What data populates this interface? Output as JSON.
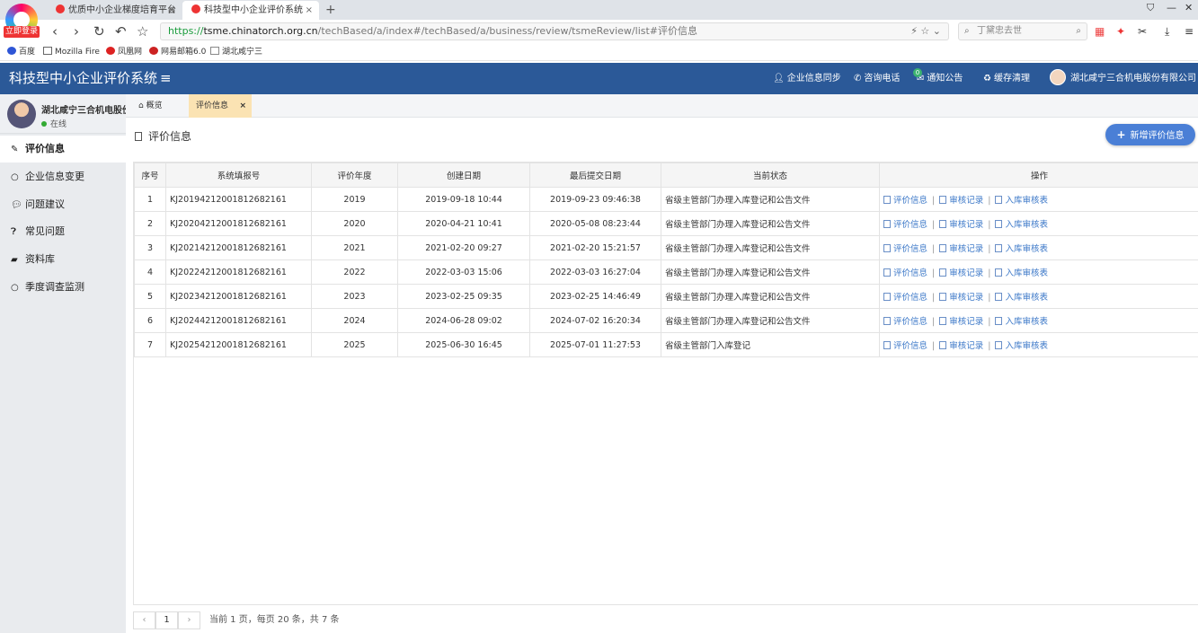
{
  "browser": {
    "login_badge": "立即登录",
    "tabs": [
      {
        "title": "优质中小企业梯度培育平台",
        "close": "×"
      },
      {
        "title": "科技型中小企业评价系统",
        "close": "×"
      }
    ],
    "new_tab": "+",
    "url_scheme": "https://",
    "url_host": "tsme.chinatorch.org.cn",
    "url_path": "/techBased/a/index#/techBased/a/business/review/tsmeReview/list#评价信息",
    "search_placeholder": "丁黛忠去世",
    "bookmarks": [
      "百度",
      "Mozilla Fire",
      "凤凰网",
      "网易邮箱6.0",
      "湖北咸宁三"
    ]
  },
  "header": {
    "title": "科技型中小企业评价系统",
    "items": [
      {
        "label": "企业信息同步",
        "icon": "user-icon"
      },
      {
        "label": "咨询电话",
        "icon": "phone-icon"
      },
      {
        "label": "通知公告",
        "icon": "mail-icon",
        "badge": "0"
      },
      {
        "label": "缓存清理",
        "icon": "recycle-icon"
      }
    ],
    "company": "湖北咸宁三合机电股份有限公司"
  },
  "sidebar": {
    "user_name": "湖北咸宁三合机电股份",
    "status": "在线",
    "items": [
      {
        "label": "评价信息",
        "icon": "edit-icon"
      },
      {
        "label": "企业信息变更",
        "icon": "circle-icon"
      },
      {
        "label": "问题建议",
        "icon": "comment-icon"
      },
      {
        "label": "常见问题",
        "icon": "question-icon"
      },
      {
        "label": "资料库",
        "icon": "folder-icon"
      },
      {
        "label": "季度调查监测",
        "icon": "circle-icon"
      }
    ]
  },
  "content_tabs": {
    "home": "概览",
    "current": "评价信息",
    "close": "×"
  },
  "panel": {
    "title": "评价信息",
    "add_button": "新增评价信息"
  },
  "table": {
    "headers": [
      "序号",
      "系统填报号",
      "评价年度",
      "创建日期",
      "最后提交日期",
      "当前状态",
      "操作"
    ],
    "actions": [
      "评价信息",
      "审核记录",
      "入库审核表"
    ],
    "rows": [
      [
        "1",
        "KJ20194212001812682161",
        "2019",
        "2019-09-18 10:44",
        "2019-09-23 09:46:38",
        "省级主管部门办理入库登记和公告文件"
      ],
      [
        "2",
        "KJ20204212001812682161",
        "2020",
        "2020-04-21 10:41",
        "2020-05-08 08:23:44",
        "省级主管部门办理入库登记和公告文件"
      ],
      [
        "3",
        "KJ20214212001812682161",
        "2021",
        "2021-02-20 09:27",
        "2021-02-20 15:21:57",
        "省级主管部门办理入库登记和公告文件"
      ],
      [
        "4",
        "KJ20224212001812682161",
        "2022",
        "2022-03-03 15:06",
        "2022-03-03 16:27:04",
        "省级主管部门办理入库登记和公告文件"
      ],
      [
        "5",
        "KJ20234212001812682161",
        "2023",
        "2023-02-25 09:35",
        "2023-02-25 14:46:49",
        "省级主管部门办理入库登记和公告文件"
      ],
      [
        "6",
        "KJ20244212001812682161",
        "2024",
        "2024-06-28 09:02",
        "2024-07-02 16:20:34",
        "省级主管部门办理入库登记和公告文件"
      ],
      [
        "7",
        "KJ20254212001812682161",
        "2025",
        "2025-06-30 16:45",
        "2025-07-01 11:27:53",
        "省级主管部门入库登记"
      ]
    ]
  },
  "pager": {
    "prev": "‹",
    "page": "1",
    "next": "›",
    "text": "当前  1  页，每页 20 条，共 7 条"
  },
  "colors": {
    "header_bg": "#2b5998",
    "accent": "#4a7fd6",
    "active_tab": "#fbe3b3"
  }
}
